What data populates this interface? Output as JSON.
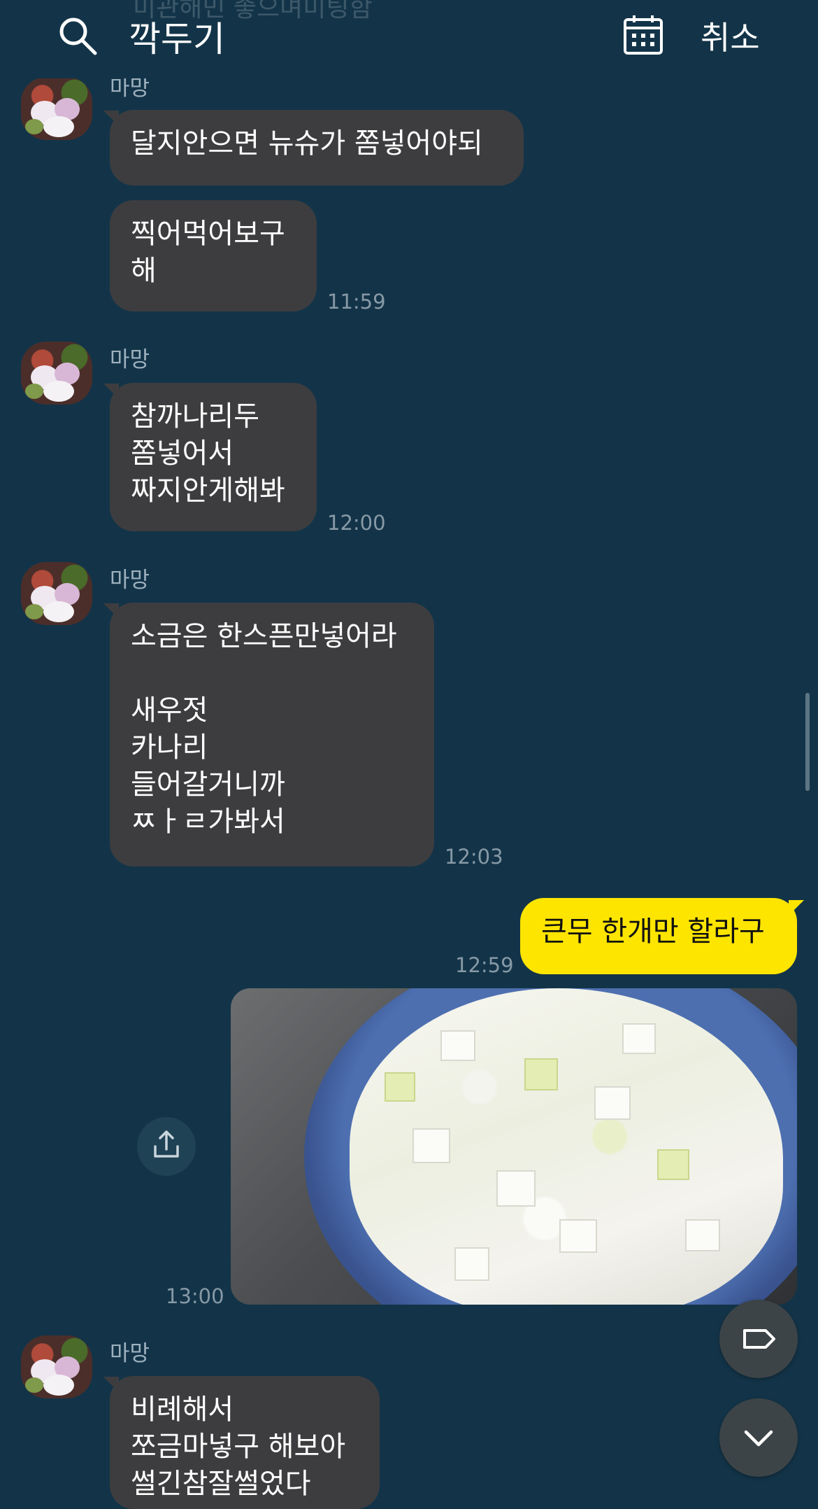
{
  "header": {
    "search_text": "깍두기",
    "cancel_label": "취소",
    "faded_text": "미관해민 좋으며미팅함"
  },
  "messages": [
    {
      "sender": "마망",
      "bubbles": [
        "달지안으면 뉴슈가 쫌넣어야되",
        "찍어먹어보구\n해"
      ],
      "time": "11:59"
    },
    {
      "sender": "마망",
      "bubbles": [
        "참까나리두\n쫌넣어서\n짜지안게해봐"
      ],
      "time": "12:00"
    },
    {
      "sender": "마망",
      "bubbles": [
        "소금은 한스픈만넣어라\n\n새우젓\n카나리\n들어갈거니까\nㅉㅏㄹ가봐서"
      ],
      "time": "12:03"
    }
  ],
  "my_messages": [
    {
      "text": "큰무 한개만 할라구",
      "time": "12:59"
    },
    {
      "image_label": "diced radish photo",
      "time": "13:00"
    }
  ],
  "last_message": {
    "sender": "마망",
    "text": "비례해서\n쪼금마넣구 해보아\n썰긴참잘썰었다"
  },
  "icons": {
    "search": "search-icon",
    "calendar": "calendar-icon",
    "share": "share-icon",
    "tag": "tag-icon",
    "scroll_down": "chevron-down-icon"
  },
  "colors": {
    "background": "#133448",
    "bubble_other": "#3d3d3f",
    "bubble_me": "#fee500"
  }
}
